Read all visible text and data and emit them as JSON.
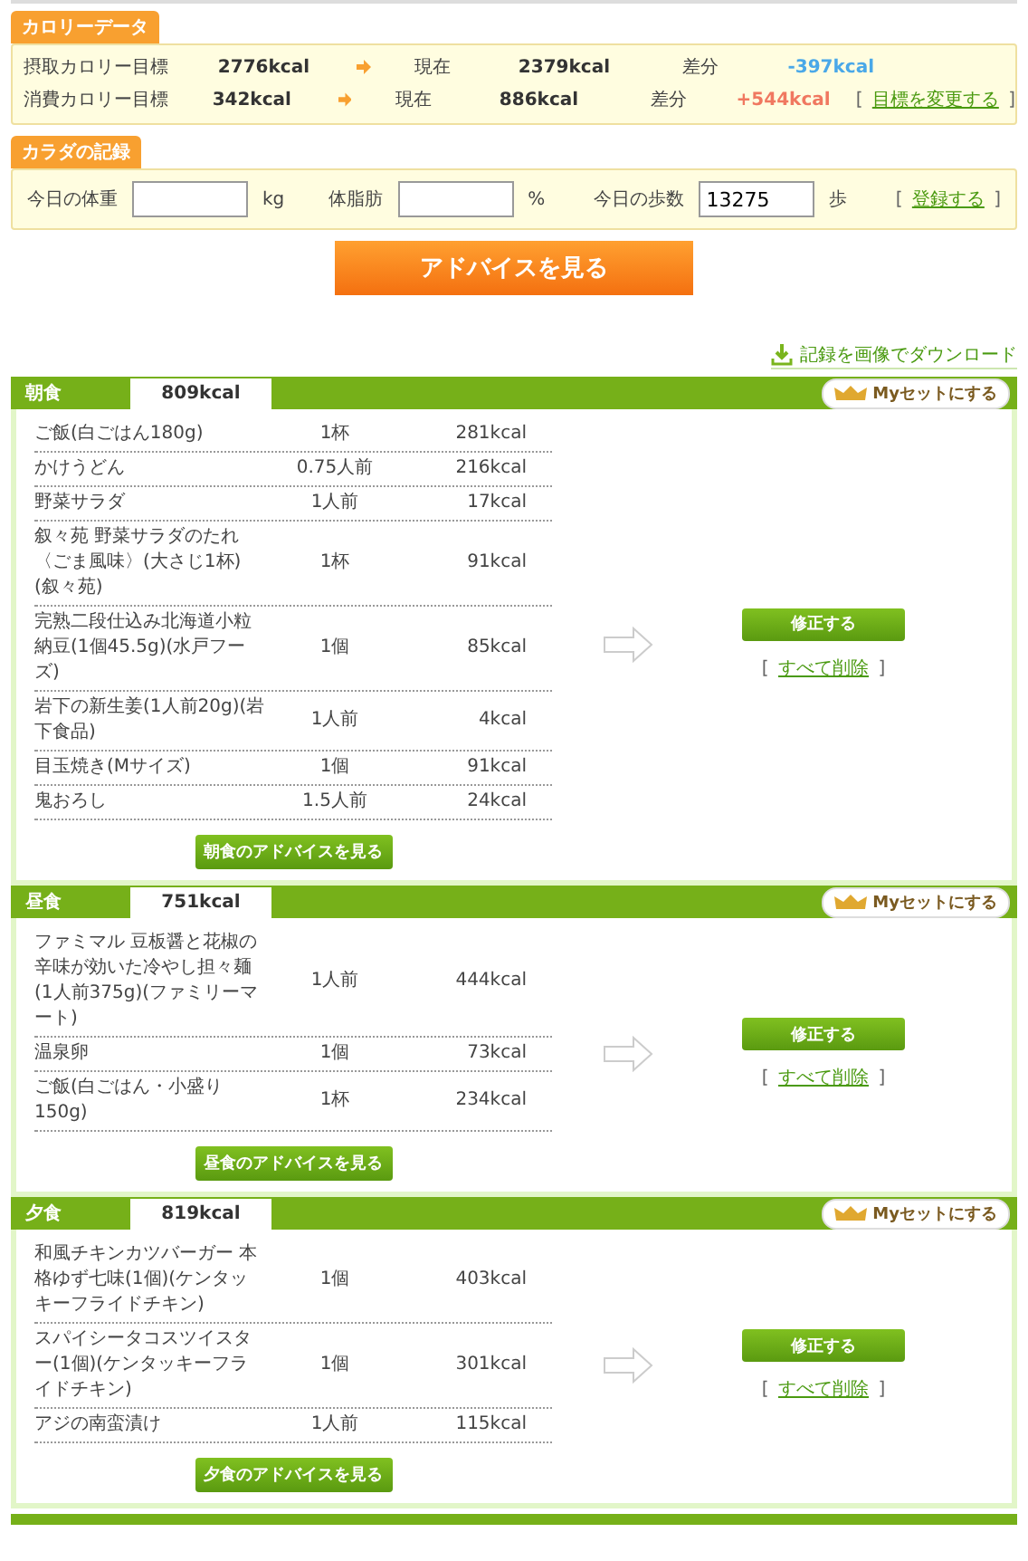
{
  "calorie_data": {
    "title": "カロリーデータ",
    "rows": [
      {
        "label": "摂取カロリー目標",
        "target": "2776kcal",
        "current_label": "現在",
        "current": "2379kcal",
        "diff_label": "差分",
        "diff": "-397kcal",
        "color": "#4aa8e8"
      },
      {
        "label": "消費カロリー目標",
        "target": "342kcal",
        "current_label": "現在",
        "current": "886kcal",
        "diff_label": "差分",
        "diff": "+544kcal",
        "color": "#f07860"
      }
    ],
    "link_open": "[",
    "link": "目標を変更する",
    "link_close": "]"
  },
  "body_record": {
    "title": "カラダの記録",
    "fields": [
      {
        "label": "今日の体重",
        "unit": "kg"
      },
      {
        "label": "体脂肪",
        "unit": "%"
      },
      {
        "label": "今日の歩数",
        "value": "13275",
        "unit": "歩"
      }
    ],
    "link_open": "[",
    "link": "登録する",
    "link_close": "]"
  },
  "advice_button": "アドバイスを見る",
  "download_link": "記録を画像でダウンロード",
  "meals": [
    {
      "name": "朝食",
      "total": "809kcal",
      "myset": "Myセットにする",
      "advice": "朝食のアドバイスを見る",
      "edit": "修正する",
      "delete_open": "[",
      "delete": "すべて削除",
      "delete_close": "]",
      "items": [
        {
          "food": "ご飯(白ごはん180g)",
          "amount": "1杯",
          "kcal": "281kcal"
        },
        {
          "food": "かけうどん",
          "amount": "0.75人前",
          "kcal": "216kcal"
        },
        {
          "food": "野菜サラダ",
          "amount": "1人前",
          "kcal": "17kcal"
        },
        {
          "food": "叙々苑 野菜サラダのたれ〈ごま風味〉(大さじ1杯)(叙々苑)",
          "amount": "1杯",
          "kcal": "91kcal"
        },
        {
          "food": "完熟二段仕込み北海道小粒納豆(1個45.5g)(水戸フーズ)",
          "amount": "1個",
          "kcal": "85kcal"
        },
        {
          "food": "岩下の新生姜(1人前20g)(岩下食品)",
          "amount": "1人前",
          "kcal": "4kcal"
        },
        {
          "food": "目玉焼き(Mサイズ)",
          "amount": "1個",
          "kcal": "91kcal"
        },
        {
          "food": "鬼おろし",
          "amount": "1.5人前",
          "kcal": "24kcal"
        }
      ]
    },
    {
      "name": "昼食",
      "total": "751kcal",
      "myset": "Myセットにする",
      "advice": "昼食のアドバイスを見る",
      "edit": "修正する",
      "delete_open": "[",
      "delete": "すべて削除",
      "delete_close": "]",
      "items": [
        {
          "food": "ファミマル 豆板醤と花椒の辛味が効いた冷やし担々麺(1人前375g)(ファミリーマート)",
          "amount": "1人前",
          "kcal": "444kcal"
        },
        {
          "food": "温泉卵",
          "amount": "1個",
          "kcal": "73kcal"
        },
        {
          "food": "ご飯(白ごはん・小盛り150g)",
          "amount": "1杯",
          "kcal": "234kcal"
        }
      ]
    },
    {
      "name": "夕食",
      "total": "819kcal",
      "myset": "Myセットにする",
      "advice": "夕食のアドバイスを見る",
      "edit": "修正する",
      "delete_open": "[",
      "delete": "すべて削除",
      "delete_close": "]",
      "items": [
        {
          "food": "和風チキンカツバーガー 本格ゆず七味(1個)(ケンタッキーフライドチキン)",
          "amount": "1個",
          "kcal": "403kcal"
        },
        {
          "food": "スパイシータコスツイスター(1個)(ケンタッキーフライドチキン)",
          "amount": "1個",
          "kcal": "301kcal"
        },
        {
          "food": "アジの南蛮漬け",
          "amount": "1人前",
          "kcal": "115kcal"
        }
      ]
    }
  ]
}
